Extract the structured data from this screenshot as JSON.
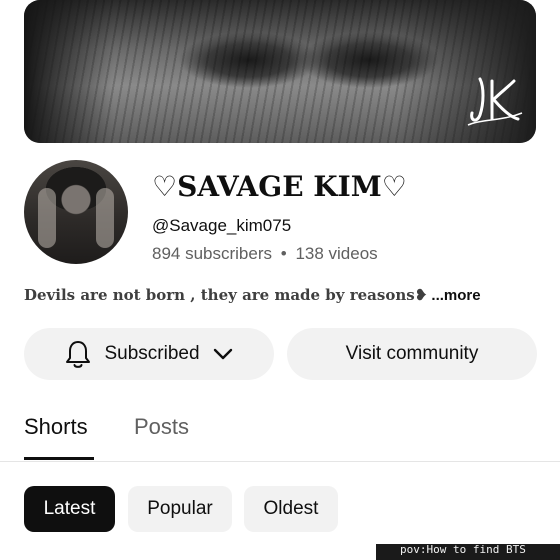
{
  "channel": {
    "name": "♡SAVAGE KIM♡",
    "handle": "@Savage_kim075",
    "subscribers": "894 subscribers",
    "separator": "•",
    "videos": "138 videos",
    "description": "Devils are not born , they are made by reasons❥",
    "more_label": " ...more"
  },
  "banner": {
    "logo_text": "JK"
  },
  "actions": {
    "subscribed_label": "Subscribed",
    "community_label": "Visit community"
  },
  "tabs": [
    {
      "label": "Shorts",
      "selected": true
    },
    {
      "label": "Posts",
      "selected": false
    }
  ],
  "filters": [
    {
      "label": "Latest",
      "selected": true
    },
    {
      "label": "Popular",
      "selected": false
    },
    {
      "label": "Oldest",
      "selected": false
    }
  ],
  "short_preview": {
    "caption": "pov:How to find BTS"
  },
  "icons": {
    "bell": "bell-icon",
    "chevron": "chevron-down-icon"
  },
  "colors": {
    "text": "#0f0f0f",
    "secondary_text": "#606060",
    "chip_bg": "#f2f2f2",
    "chip_selected_bg": "#0f0f0f"
  }
}
